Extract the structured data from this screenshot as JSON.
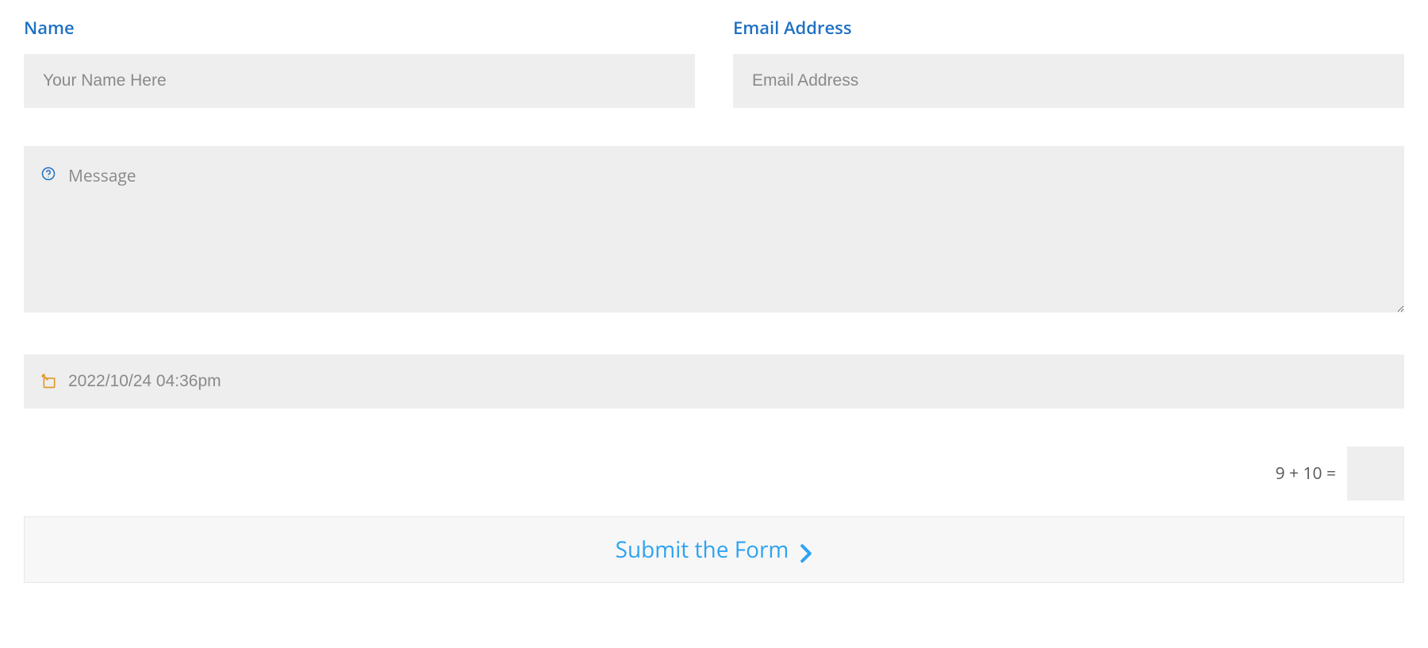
{
  "fields": {
    "name": {
      "label": "Name",
      "placeholder": "Your Name Here",
      "value": ""
    },
    "email": {
      "label": "Email Address",
      "placeholder": "Email Address",
      "value": ""
    },
    "message": {
      "placeholder": "Message",
      "value": ""
    },
    "datetime": {
      "value": "2022/10/24 04:36pm"
    }
  },
  "captcha": {
    "question": "9 + 10 =",
    "value": ""
  },
  "submit": {
    "label": "Submit the Form"
  }
}
